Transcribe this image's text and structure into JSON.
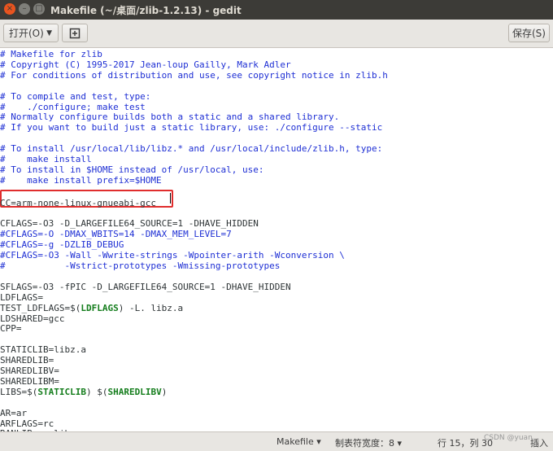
{
  "window": {
    "title": "Makefile (~/桌面/zlib-1.2.13) - gedit",
    "close_glyph": "×",
    "min_glyph": "–",
    "max_glyph": "□"
  },
  "toolbar": {
    "open_label": "打开(O)",
    "open_chevron": "▼",
    "new_document_glyph": "⊞",
    "save_label": "保存(S)"
  },
  "editor": {
    "lines": [
      "# Makefile for zlib",
      "# Copyright (C) 1995-2017 Jean-loup Gailly, Mark Adler",
      "# For conditions of distribution and use, see copyright notice in zlib.h",
      "",
      "# To compile and test, type:",
      "#    ./configure; make test",
      "# Normally configure builds both a static and a shared library.",
      "# If you want to build just a static library, use: ./configure --static",
      "",
      "# To install /usr/local/lib/libz.* and /usr/local/include/zlib.h, type:",
      "#    make install",
      "# To install in $HOME instead of /usr/local, use:",
      "#    make install prefix=$HOME",
      "",
      "CC=arm-none-linux-gnueabi-gcc",
      "",
      "CFLAGS=-O3 -D_LARGEFILE64_SOURCE=1 -DHAVE_HIDDEN",
      "#CFLAGS=-O -DMAX_WBITS=14 -DMAX_MEM_LEVEL=7",
      "#CFLAGS=-g -DZLIB_DEBUG",
      "#CFLAGS=-O3 -Wall -Wwrite-strings -Wpointer-arith -Wconversion \\",
      "#           -Wstrict-prototypes -Wmissing-prototypes",
      "",
      "SFLAGS=-O3 -fPIC -D_LARGEFILE64_SOURCE=1 -DHAVE_HIDDEN",
      "LDFLAGS=",
      "TEST_LDFLAGS=$(LDFLAGS) -L. libz.a",
      "LDSHARED=gcc",
      "CPP=",
      "",
      "STATICLIB=libz.a",
      "SHAREDLIB=",
      "SHAREDLIBV=",
      "SHAREDLIBM=",
      "LIBS=$(STATICLIB) $(SHAREDLIBV)",
      "",
      "AR=ar",
      "ARFLAGS=rc",
      "RANLIB=ranlib"
    ]
  },
  "statusbar": {
    "language": "Makefile",
    "tab_width": "制表符宽度：8",
    "position": "行 15，列 30",
    "insert_mode": "插入",
    "dropdown_glyph": "▾"
  },
  "watermark": "CSDN @yuan..."
}
